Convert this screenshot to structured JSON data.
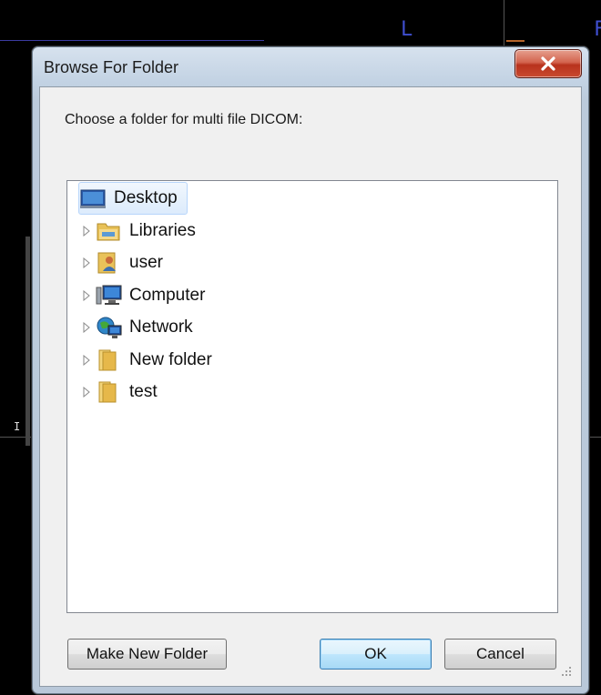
{
  "dialog": {
    "title": "Browse For Folder",
    "prompt": "Choose a folder for multi file DICOM:",
    "close_label": "Close"
  },
  "tree": {
    "selected": "Desktop",
    "items": [
      {
        "label": "Desktop",
        "icon": "desktop-icon",
        "expander": false
      },
      {
        "label": "Libraries",
        "icon": "libraries-icon",
        "expander": true
      },
      {
        "label": "user",
        "icon": "user-folder-icon",
        "expander": true
      },
      {
        "label": "Computer",
        "icon": "computer-icon",
        "expander": true
      },
      {
        "label": "Network",
        "icon": "network-icon",
        "expander": true
      },
      {
        "label": "New folder",
        "icon": "folder-icon",
        "expander": true
      },
      {
        "label": "test",
        "icon": "folder-icon",
        "expander": true
      }
    ]
  },
  "buttons": {
    "make_new_folder": "Make New Folder",
    "ok": "OK",
    "cancel": "Cancel"
  },
  "background": {
    "glyph_left": "L",
    "glyph_right": "F",
    "glyph_marker": "I"
  },
  "colors": {
    "accent": "#3c7fb1",
    "close": "#c94a2f",
    "selection": "#dcebfc"
  }
}
